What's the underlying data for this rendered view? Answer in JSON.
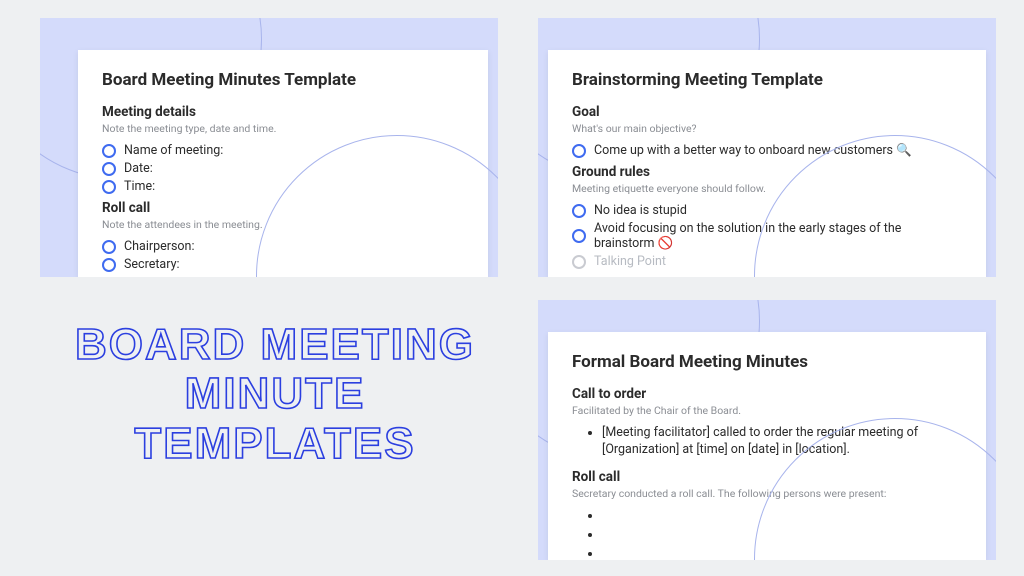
{
  "headline": "BOARD MEETING MINUTE TEMPLATES",
  "cards": {
    "board": {
      "title": "Board Meeting Minutes Template",
      "sec1_title": "Meeting details",
      "sec1_sub": "Note the meeting type, date and time.",
      "items1": {
        "a": "Name of meeting:",
        "b": "Date:",
        "c": "Time:"
      },
      "sec2_title": "Roll call",
      "sec2_sub": "Note the attendees in the meeting.",
      "items2": {
        "a": "Chairperson:",
        "b": "Secretary:"
      }
    },
    "brain": {
      "title": "Brainstorming Meeting Template",
      "sec1_title": "Goal",
      "sec1_sub": "What's our main objective?",
      "items1": {
        "a": "Come up with a better way to onboard new customers 🔍"
      },
      "sec2_title": "Ground rules",
      "sec2_sub": "Meeting etiquette everyone should follow.",
      "items2": {
        "a": "No idea is stupid",
        "b": "Avoid focusing on the solution in the early stages of the brainstorm 🚫",
        "c": "Talking Point"
      }
    },
    "formal": {
      "title": "Formal Board Meeting Minutes",
      "sec1_title": "Call to order",
      "sec1_sub": "Facilitated by the Chair of the Board.",
      "bullet1": "[Meeting facilitator] called to order the regular meeting of [Organization] at [time] on [date] in [location].",
      "sec2_title": "Roll call",
      "sec2_sub": "Secretary conducted a roll call. The following persons were present:"
    }
  }
}
